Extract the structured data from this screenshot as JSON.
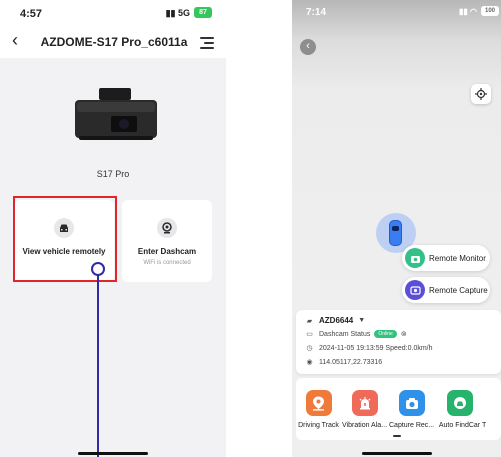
{
  "left_screen": {
    "status_time": "4:57",
    "network": "5G",
    "battery": "87",
    "title": "AZDOME-S17 Pro_c6011a",
    "model_name": "S17 Pro",
    "view_remote_label": "View vehicle remotely",
    "enter_dashcam_label": "Enter Dashcam",
    "wifi_status": "WiFi is connected",
    "highlight_color": "#e2252b",
    "pointer_color": "#2f2ba6"
  },
  "right_screen": {
    "status_time": "7:14",
    "battery": "100",
    "remote_monitor_label": "Remote Monitor",
    "remote_capture_label": "Remote Capture",
    "device_name": "AZD6644",
    "dashcam_status_label": "Dashcam Status",
    "online_badge": "Online",
    "datetime_speed": "2024-11-05 19:13:59 Speed:0.0km/h",
    "coordinates": "114.05117,22.73316",
    "tools": [
      {
        "label": "Driving Track",
        "icon": "map-pin-icon"
      },
      {
        "label": "Vibration Ala...",
        "icon": "alarm-icon"
      },
      {
        "label": "Capture Rec...",
        "icon": "camera-icon"
      },
      {
        "label": "Auto FindCar",
        "icon": "find-car-icon"
      },
      {
        "label": "T",
        "icon": ""
      }
    ]
  }
}
